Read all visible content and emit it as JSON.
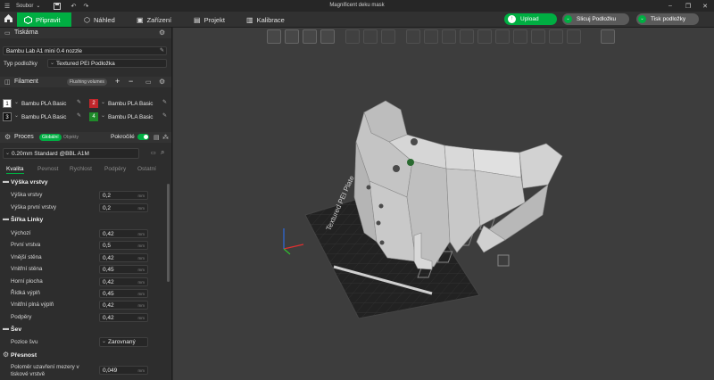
{
  "window": {
    "title": "Magnificent deku mask",
    "menu_label": "Soubor"
  },
  "tabs": {
    "prepare": "Připravit",
    "preview": "Náhled",
    "device": "Zařízení",
    "project": "Projekt",
    "calibration": "Kalibrace"
  },
  "actions": {
    "upload": "Upload",
    "slice_plate": "Slicuj Podložku",
    "print_plate": "Tisk podložky"
  },
  "printer": {
    "section_title": "Tiskárna",
    "name": "Bambu Lab A1 mini 0.4 nozzle",
    "plate_type_label": "Typ podložky",
    "plate_type_value": "Textured PEI Podložka"
  },
  "filament": {
    "section_title": "Filament",
    "flushing_label": "Flushing volumes",
    "slots": [
      {
        "num": "1",
        "name": "Bambu PLA Basic",
        "color": "#ffffff",
        "text_color": "#000000"
      },
      {
        "num": "2",
        "name": "Bambu PLA Basic",
        "color": "#c0262b",
        "text_color": "#ffffff"
      },
      {
        "num": "3",
        "name": "Bambu PLA Basic",
        "color": "#111111",
        "text_color": "#ffffff"
      },
      {
        "num": "4",
        "name": "Bambu PLA Basic",
        "color": "#1f8a2a",
        "text_color": "#ffffff"
      }
    ]
  },
  "process": {
    "section_title": "Proces",
    "global_label": "Globální",
    "objects_label": "Objekty",
    "advanced_label": "Pokročilé",
    "preset": "0.20mm Standard @BBL A1M",
    "tabs": [
      "Kvalita",
      "Pevnost",
      "Rychlost",
      "Podpěry",
      "Ostatní"
    ],
    "groups": {
      "layer_height": {
        "title": "Výška vrstvy",
        "params": [
          {
            "label": "Výška vrstvy",
            "value": "0,2",
            "unit": "mm"
          },
          {
            "label": "Výška první vrstvy",
            "value": "0,2",
            "unit": "mm"
          }
        ]
      },
      "line_width": {
        "title": "Šířka Linky",
        "params": [
          {
            "label": "Výchozí",
            "value": "0,42",
            "unit": "mm"
          },
          {
            "label": "První vrstva",
            "value": "0,5",
            "unit": "mm"
          },
          {
            "label": "Vnější stěna",
            "value": "0,42",
            "unit": "mm"
          },
          {
            "label": "Vnitřní stěna",
            "value": "0,45",
            "unit": "mm"
          },
          {
            "label": "Horní plocha",
            "value": "0,42",
            "unit": "mm"
          },
          {
            "label": "Řídká výplň",
            "value": "0,45",
            "unit": "mm"
          },
          {
            "label": "Vnitřní plná výplň",
            "value": "0,42",
            "unit": "mm"
          },
          {
            "label": "Podpěry",
            "value": "0,42",
            "unit": "mm"
          }
        ]
      },
      "seam": {
        "title": "Šev",
        "params": [
          {
            "label": "Pozice švu",
            "value": "Zarovnaný"
          }
        ]
      },
      "precision": {
        "title": "Přesnost",
        "params": [
          {
            "label": "Poloměr uzavření mezery v tiskové vrstvě",
            "value": "0,049",
            "unit": "mm"
          }
        ]
      }
    }
  },
  "bed_label": "Textured PEI Plate",
  "colors": {
    "accent": "#00ae42",
    "viewport_bg": "#3d3d3d",
    "sidebar_bg": "#2d2d2d"
  }
}
